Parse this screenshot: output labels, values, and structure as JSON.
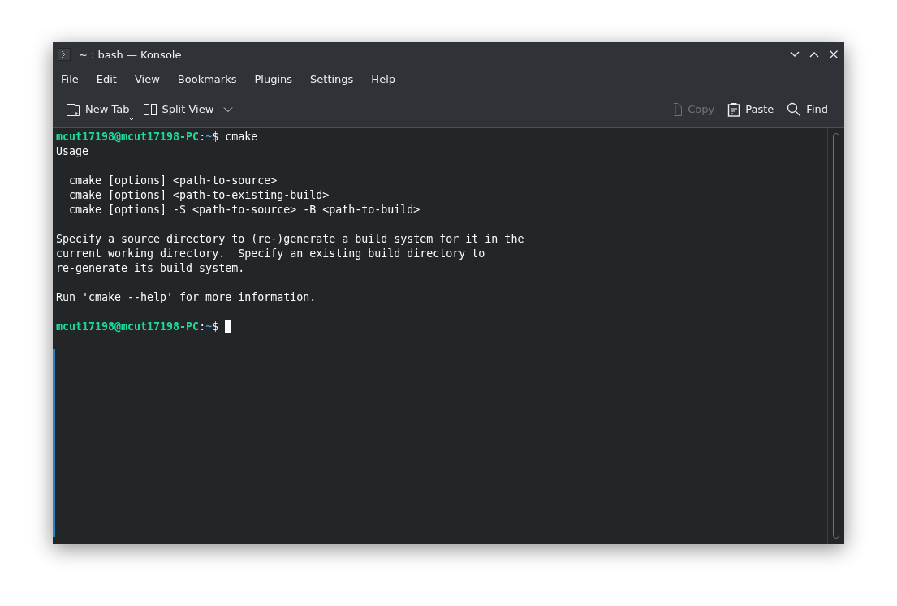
{
  "window": {
    "title": "~ : bash — Konsole"
  },
  "menu": [
    "File",
    "Edit",
    "View",
    "Bookmarks",
    "Plugins",
    "Settings",
    "Help"
  ],
  "toolbar_left": [
    {
      "kind": "new-tab",
      "label": "New Tab",
      "disabled": false
    },
    {
      "kind": "split-view",
      "label": "Split View",
      "disabled": false
    }
  ],
  "toolbar_right": [
    {
      "kind": "copy",
      "label": "Copy",
      "disabled": true
    },
    {
      "kind": "paste",
      "label": "Paste",
      "disabled": false
    },
    {
      "kind": "find",
      "label": "Find",
      "disabled": false
    }
  ],
  "terminal": {
    "lines": [
      {
        "kind": "prompt",
        "user_host": "mcut17198@mcut17198-PC",
        "colon": ":",
        "path": "~",
        "symbol": "$",
        "command": "cmake",
        "cursor": false
      },
      {
        "kind": "output",
        "text": "Usage"
      },
      {
        "kind": "blank"
      },
      {
        "kind": "output",
        "text": "  cmake [options] <path-to-source>"
      },
      {
        "kind": "output",
        "text": "  cmake [options] <path-to-existing-build>"
      },
      {
        "kind": "output",
        "text": "  cmake [options] -S <path-to-source> -B <path-to-build>"
      },
      {
        "kind": "blank"
      },
      {
        "kind": "output",
        "text": "Specify a source directory to (re-)generate a build system for it in the"
      },
      {
        "kind": "output",
        "text": "current working directory.  Specify an existing build directory to"
      },
      {
        "kind": "output",
        "text": "re-generate its build system."
      },
      {
        "kind": "blank"
      },
      {
        "kind": "output",
        "text": "Run 'cmake --help' for more information."
      },
      {
        "kind": "blank"
      },
      {
        "kind": "prompt",
        "user_host": "mcut17198@mcut17198-PC",
        "colon": ":",
        "path": "~",
        "symbol": "$",
        "cursor": true
      }
    ]
  }
}
